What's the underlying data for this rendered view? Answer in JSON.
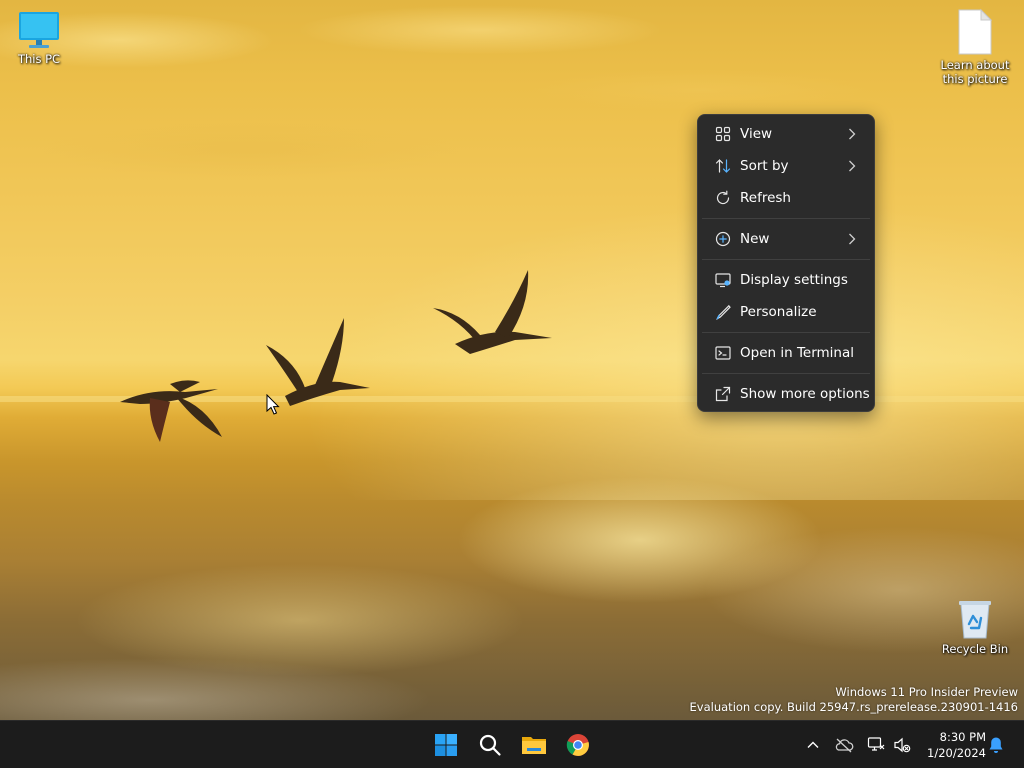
{
  "desktop": {
    "icons": {
      "this_pc": "This PC",
      "learn_line1": "Learn about",
      "learn_line2": "this picture",
      "recycle_bin": "Recycle Bin"
    },
    "watermark": {
      "line1": "Windows 11 Pro Insider Preview",
      "line2": "Evaluation copy. Build 25947.rs_prerelease.230901-1416"
    }
  },
  "context_menu": {
    "items": [
      {
        "label": "View",
        "icon": "grid-icon",
        "submenu": true
      },
      {
        "label": "Sort by",
        "icon": "sort-icon",
        "submenu": true
      },
      {
        "label": "Refresh",
        "icon": "refresh-icon",
        "submenu": false
      },
      {
        "label": "New",
        "icon": "plus-circle-icon",
        "submenu": true
      },
      {
        "label": "Display settings",
        "icon": "display-settings-icon",
        "submenu": false
      },
      {
        "label": "Personalize",
        "icon": "pen-icon",
        "submenu": false
      },
      {
        "label": "Open in Terminal",
        "icon": "terminal-icon",
        "submenu": false
      },
      {
        "label": "Show more options",
        "icon": "share-icon",
        "submenu": false
      }
    ]
  },
  "taskbar": {
    "apps": [
      "windows-start-icon",
      "search-icon",
      "file-explorer-icon",
      "chrome-icon"
    ],
    "tray": [
      "chevron-up-icon",
      "onedrive-icon",
      "network-icon",
      "speaker-muted-icon",
      "notification-bell-icon"
    ],
    "clock": {
      "time": "8:30 PM",
      "date": "1/20/2024"
    }
  },
  "colors": {
    "menu_bg": "#2b2b2b",
    "taskbar_bg": "#1c1c1c",
    "accent": "#0078d4"
  }
}
